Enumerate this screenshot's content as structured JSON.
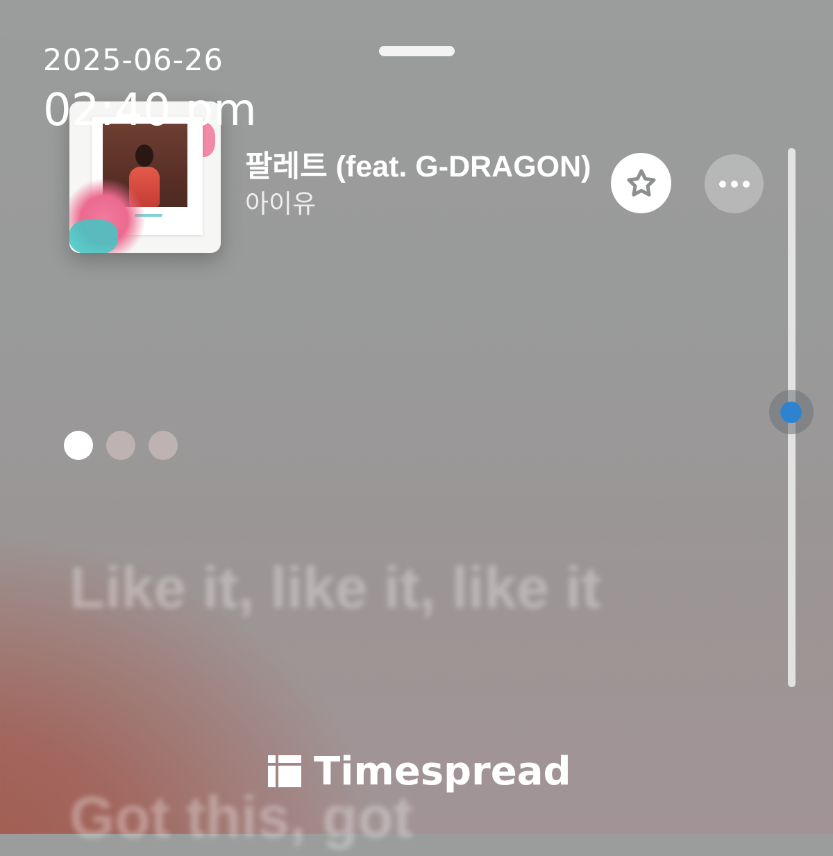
{
  "timestamp": {
    "date": "2025-06-26",
    "time": "02:40 pm"
  },
  "now_playing": {
    "title": "팔레트 (feat. G-DRAGON)",
    "artist": "아이유",
    "album_art": "album-cover"
  },
  "actions": {
    "favorite_icon": "star-icon",
    "more_icon": "more-horizontal-icon"
  },
  "pager": {
    "count": 3,
    "active_index": 0
  },
  "lyrics": {
    "current": "Like it, like it, like it",
    "next": "Got this, got"
  },
  "scrollbar": {
    "position_fraction": 0.49
  },
  "watermark": {
    "brand": "Timespread",
    "icon": "timespread-logo-icon"
  },
  "colors": {
    "accent_blue": "#2e83d0",
    "lyric_fade": "rgba(255,255,255,0.32)",
    "warm_glow": "#a2584c"
  }
}
